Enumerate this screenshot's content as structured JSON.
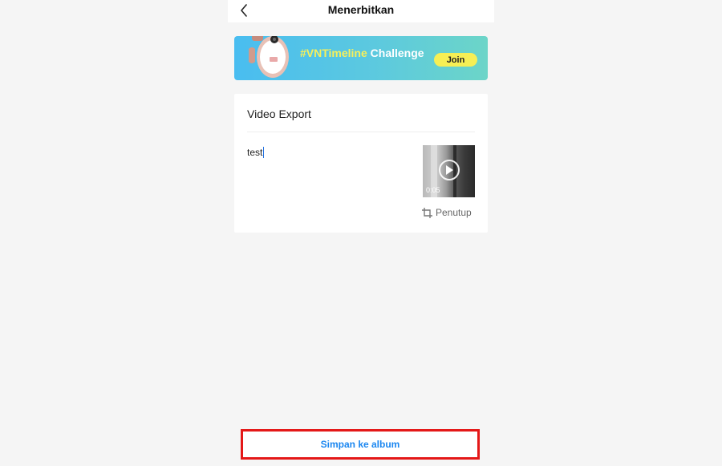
{
  "header": {
    "title": "Menerbitkan",
    "back_icon": "chevron-left-icon"
  },
  "banner": {
    "hashtag": "#VNTimeline",
    "text": " Challenge",
    "join_label": "Join",
    "colors": {
      "hashtag": "#f7f05b",
      "join_bg": "#f6ef55"
    }
  },
  "card": {
    "title": "Video Export",
    "description": "test",
    "thumbnail": {
      "duration": "0:05",
      "play_icon": "play-icon"
    },
    "cover_label": "Penutup",
    "cover_icon": "crop-icon"
  },
  "footer": {
    "save_label": "Simpan ke album",
    "colors": {
      "text": "#1a86f0",
      "highlight_border": "#e41818"
    }
  }
}
